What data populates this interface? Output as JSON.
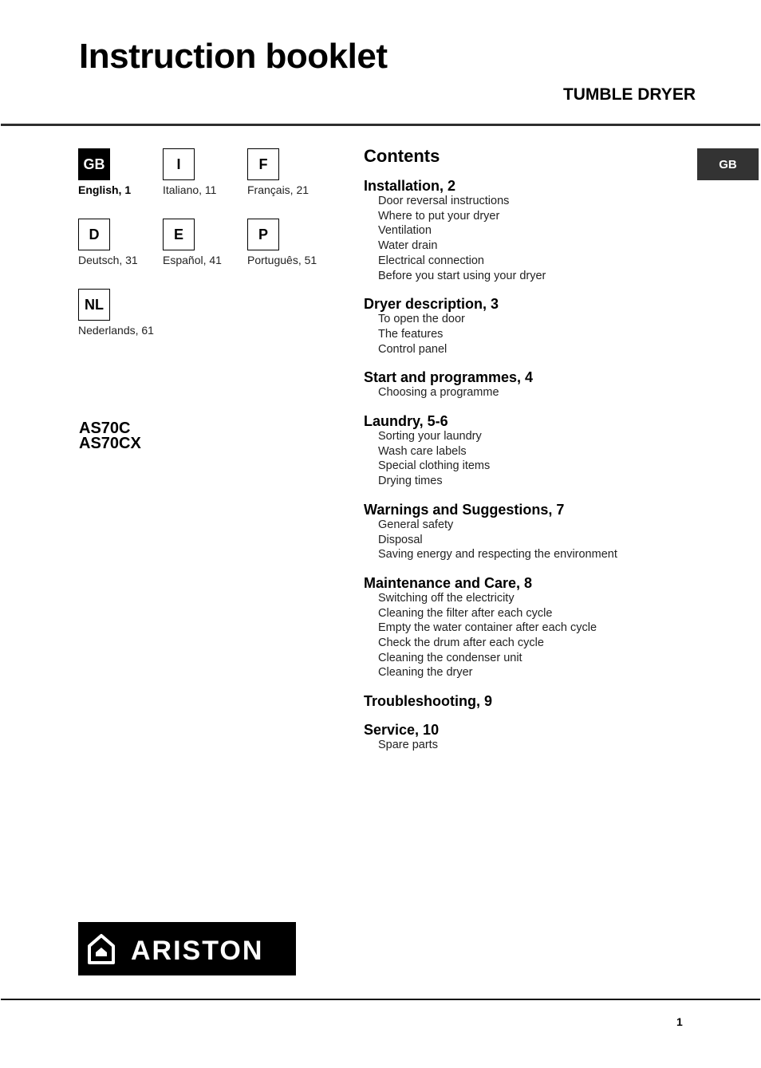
{
  "header": {
    "title": "Instruction booklet",
    "subtitle": "TUMBLE DRYER"
  },
  "languages": [
    {
      "code": "GB",
      "label": "English, 1",
      "active": true
    },
    {
      "code": "I",
      "label": "Italiano, 11",
      "active": false
    },
    {
      "code": "F",
      "label": "Français, 21",
      "active": false
    },
    {
      "code": "D",
      "label": "Deutsch, 31",
      "active": false
    },
    {
      "code": "E",
      "label": "Español, 41",
      "active": false
    },
    {
      "code": "P",
      "label": "Português, 51",
      "active": false
    },
    {
      "code": "NL",
      "label": "Nederlands, 61",
      "active": false
    }
  ],
  "models": [
    "AS70C",
    "AS70CX"
  ],
  "contents": {
    "title": "Contents",
    "sections": [
      {
        "title": "Installation, 2",
        "items": [
          "Door reversal instructions",
          "Where to put your dryer",
          "Ventilation",
          "Water drain",
          "Electrical connection",
          "Before you start using your dryer"
        ]
      },
      {
        "title": "Dryer description, 3",
        "items": [
          "To open the door",
          "The features",
          "Control panel"
        ]
      },
      {
        "title": "Start and programmes, 4",
        "items": [
          "Choosing a programme"
        ]
      },
      {
        "title": "Laundry, 5-6",
        "items": [
          "Sorting your laundry",
          "Wash care labels",
          "Special clothing items",
          "Drying times"
        ]
      },
      {
        "title": "Warnings and Suggestions, 7",
        "items": [
          "General safety",
          "Disposal",
          "Saving energy and respecting the environment"
        ]
      },
      {
        "title": "Maintenance and Care, 8",
        "items": [
          "Switching off the electricity",
          "Cleaning the filter after each cycle",
          "Empty the water container after each cycle",
          "Check the drum after each cycle",
          "Cleaning the condenser unit",
          "Cleaning the dryer"
        ]
      },
      {
        "title": "Troubleshooting, 9",
        "items": []
      },
      {
        "title": "Service, 10",
        "items": [
          "Spare parts"
        ]
      }
    ]
  },
  "side_tab": {
    "label": "GB",
    "color": "#333333"
  },
  "brand": {
    "name": "ARISTON",
    "icon": "house-icon"
  },
  "footer": {
    "page_number": "1"
  }
}
